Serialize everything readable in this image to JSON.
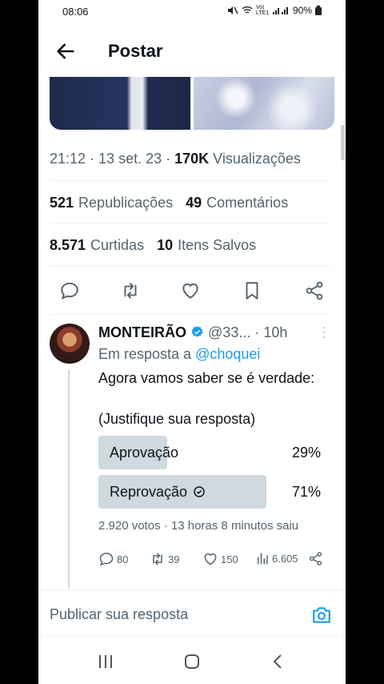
{
  "status": {
    "time": "08:06",
    "battery": "90%",
    "net": "Vo) LTE1"
  },
  "header": {
    "title": "Postar"
  },
  "tweet": {
    "time": "21:12",
    "date": "13 set. 23",
    "views_count": "170K",
    "views_label": "Visualizações",
    "reposts_count": "521",
    "reposts_label": "Republicações",
    "comments_count": "49",
    "comments_label": "Comentários",
    "likes_count": "8.571",
    "likes_label": "Curtidas",
    "saves_count": "10",
    "saves_label": "Itens Salvos"
  },
  "reply": {
    "name": "MONTEIRÃO",
    "handle": "@33...",
    "age": "· 10h",
    "in_reply_prefix": "Em resposta a",
    "in_reply_handle": "@choquei",
    "text_line1": "Agora vamos saber se é verdade:",
    "text_line2": "(Justifique sua resposta)",
    "poll": [
      {
        "label": "Aprovação",
        "percent": "29%",
        "value": 0.29
      },
      {
        "label": "Reprovação",
        "percent": "71%",
        "value": 0.71,
        "selected": true
      }
    ],
    "poll_meta": "2.920 votos · 13 horas 8 minutos saiu",
    "replies": "80",
    "reposts": "39",
    "likes": "150",
    "views": "6.605"
  },
  "compose": {
    "placeholder": "Publicar sua resposta"
  },
  "colors": {
    "accent": "#1d9bf0",
    "text": "#0f1419",
    "muted": "#536471",
    "poll_bar": "#cfd9de"
  }
}
